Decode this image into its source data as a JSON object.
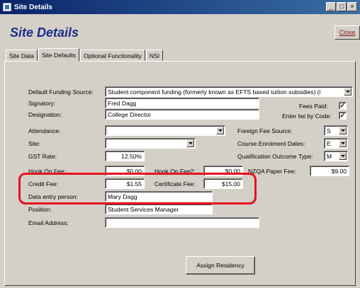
{
  "window": {
    "title": "Site Details",
    "heading": "Site Details",
    "close_label": "Close"
  },
  "tabs": [
    {
      "label": "Site Data",
      "active": false
    },
    {
      "label": "Site Defaults",
      "active": true
    },
    {
      "label": "Optional Functionality",
      "active": false
    },
    {
      "label": "NSI",
      "active": false
    }
  ],
  "form": {
    "default_funding_source": {
      "label": "Default Funding Source:",
      "value": "Student component funding (formerly known as EFTS based tuition subsidies) (i"
    },
    "signatory": {
      "label": "Signatory:",
      "value": "Fred Dagg"
    },
    "designation": {
      "label": "Designation:",
      "value": "College Director"
    },
    "fees_paid": {
      "label": "Fees Paid:",
      "checked": "✓"
    },
    "enter_iwi_by_code": {
      "label": "Enter Iwi by Code:",
      "checked": "✓"
    },
    "attendance": {
      "label": "Attendance:",
      "value": ""
    },
    "site": {
      "label": "Site:",
      "value": ""
    },
    "gst_rate": {
      "label": "GST Rate:",
      "value": "12.50%"
    },
    "foreign_fee_source": {
      "label": "Foreign Fee Source:",
      "value": "S"
    },
    "course_enrolment_dates": {
      "label": "Course Enrolment Dates:",
      "value": "E"
    },
    "qualification_outcome_type": {
      "label": "Qualification Outcome Type:",
      "value": "M"
    },
    "hook_on_fee": {
      "label": "Hook On Fee:",
      "value": "$0.00"
    },
    "hook_on_fee2": {
      "label": "Hook On Fee2:",
      "value": "$0.00"
    },
    "nzqa_paper_fee": {
      "label": "NZQA Paper Fee:",
      "value": "$9.00"
    },
    "credit_fee": {
      "label": "Credit Fee:",
      "value": "$1.55"
    },
    "certificate_fee": {
      "label": "Certificate Fee:",
      "value": "$15.00"
    },
    "data_entry_person": {
      "label": "Data entry person:",
      "value": "Mary Dagg"
    },
    "position": {
      "label": "Position:",
      "value": "Student Services Manager"
    },
    "email_address": {
      "label": "Email Address:",
      "value": ""
    }
  },
  "buttons": {
    "assign_residency": "Assign Residency"
  },
  "colors": {
    "highlight": "#e8111d",
    "heading": "#1a2e8a",
    "titlebar": "#0a246a",
    "face": "#d4d0c8"
  }
}
